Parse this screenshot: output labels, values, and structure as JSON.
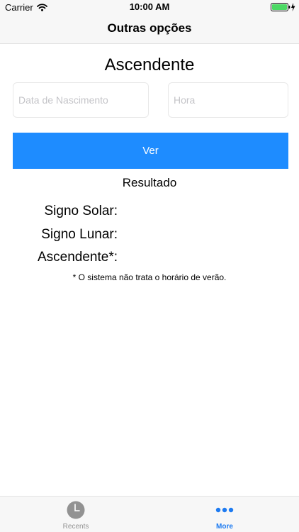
{
  "status_bar": {
    "carrier": "Carrier",
    "time": "10:00 AM",
    "battery_color": "#4cd964"
  },
  "nav_bar": {
    "title": "Outras opções"
  },
  "form": {
    "heading": "Ascendente",
    "birth_date_placeholder": "Data de Nascimento",
    "birth_date_value": "",
    "time_placeholder": "Hora",
    "time_value": "",
    "submit_label": "Ver",
    "button_color": "#1e8cff"
  },
  "result": {
    "title": "Resultado",
    "sun_sign_label": "Signo Solar:",
    "moon_sign_label": "Signo Lunar:",
    "ascendant_label": "Ascendente*:",
    "footnote": "* O sistema não trata o horário de verão."
  },
  "tab_bar": {
    "tabs": [
      {
        "label": "Recents",
        "icon": "clock-icon",
        "selected": false
      },
      {
        "label": "More",
        "icon": "more-dots-icon",
        "selected": true
      }
    ],
    "selected_color": "#1e7bf1",
    "unselected_color": "#929292"
  }
}
